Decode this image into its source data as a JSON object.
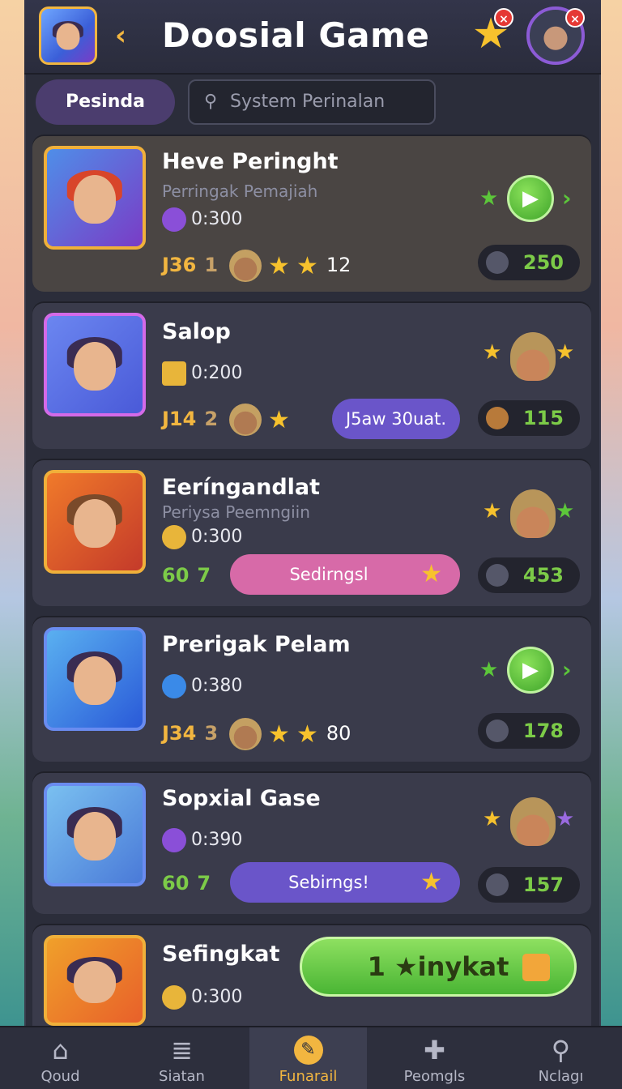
{
  "header": {
    "title": "Doosial Game",
    "back_icon": "‹",
    "star_icon": "★",
    "close_icon": "×"
  },
  "tabs": {
    "active_label": "Pesinda",
    "search_placeholder": "System Perinalan"
  },
  "games": [
    {
      "name": "Heve Peringht",
      "subtitle": "Perringak Pemajiah",
      "time": "0:300",
      "level": "J36",
      "count2": "1",
      "stars_count": "12",
      "score": "250"
    },
    {
      "name": "Salop",
      "subtitle": "",
      "time": "0:200",
      "level": "J14",
      "count2": "2",
      "tag": "J5aw 30uat.",
      "score": "115"
    },
    {
      "name": "Eeríngandlat",
      "subtitle": "Periysa Peemngiin",
      "time": "0:300",
      "level": "60",
      "count2": "7",
      "tag": "Sedirngsl",
      "score": "453"
    },
    {
      "name": "Prerigak Pelam",
      "subtitle": "",
      "time": "0:380",
      "level": "J34",
      "count2": "3",
      "stars_count": "80",
      "score": "178"
    },
    {
      "name": "Sopxial Gase",
      "subtitle": "",
      "time": "0:390",
      "level": "60",
      "count2": "7",
      "tag": "Sebirngs!",
      "score": "157"
    },
    {
      "name": "Sefingkat",
      "subtitle": "",
      "time": "0:300",
      "cta": "1 ★inykat"
    }
  ],
  "nav": [
    {
      "label": "Qoud",
      "icon": "⌂"
    },
    {
      "label": "Siatan",
      "icon": "≣"
    },
    {
      "label": "Funarail",
      "icon": "✎"
    },
    {
      "label": "Peomgls",
      "icon": "✚"
    },
    {
      "label": "Nclagı",
      "icon": "⚲"
    }
  ],
  "colors": {
    "accent_gold": "#f2b640",
    "accent_green": "#7ccb48",
    "panel": "#2b2d3a",
    "card": "#3a3b4b"
  }
}
